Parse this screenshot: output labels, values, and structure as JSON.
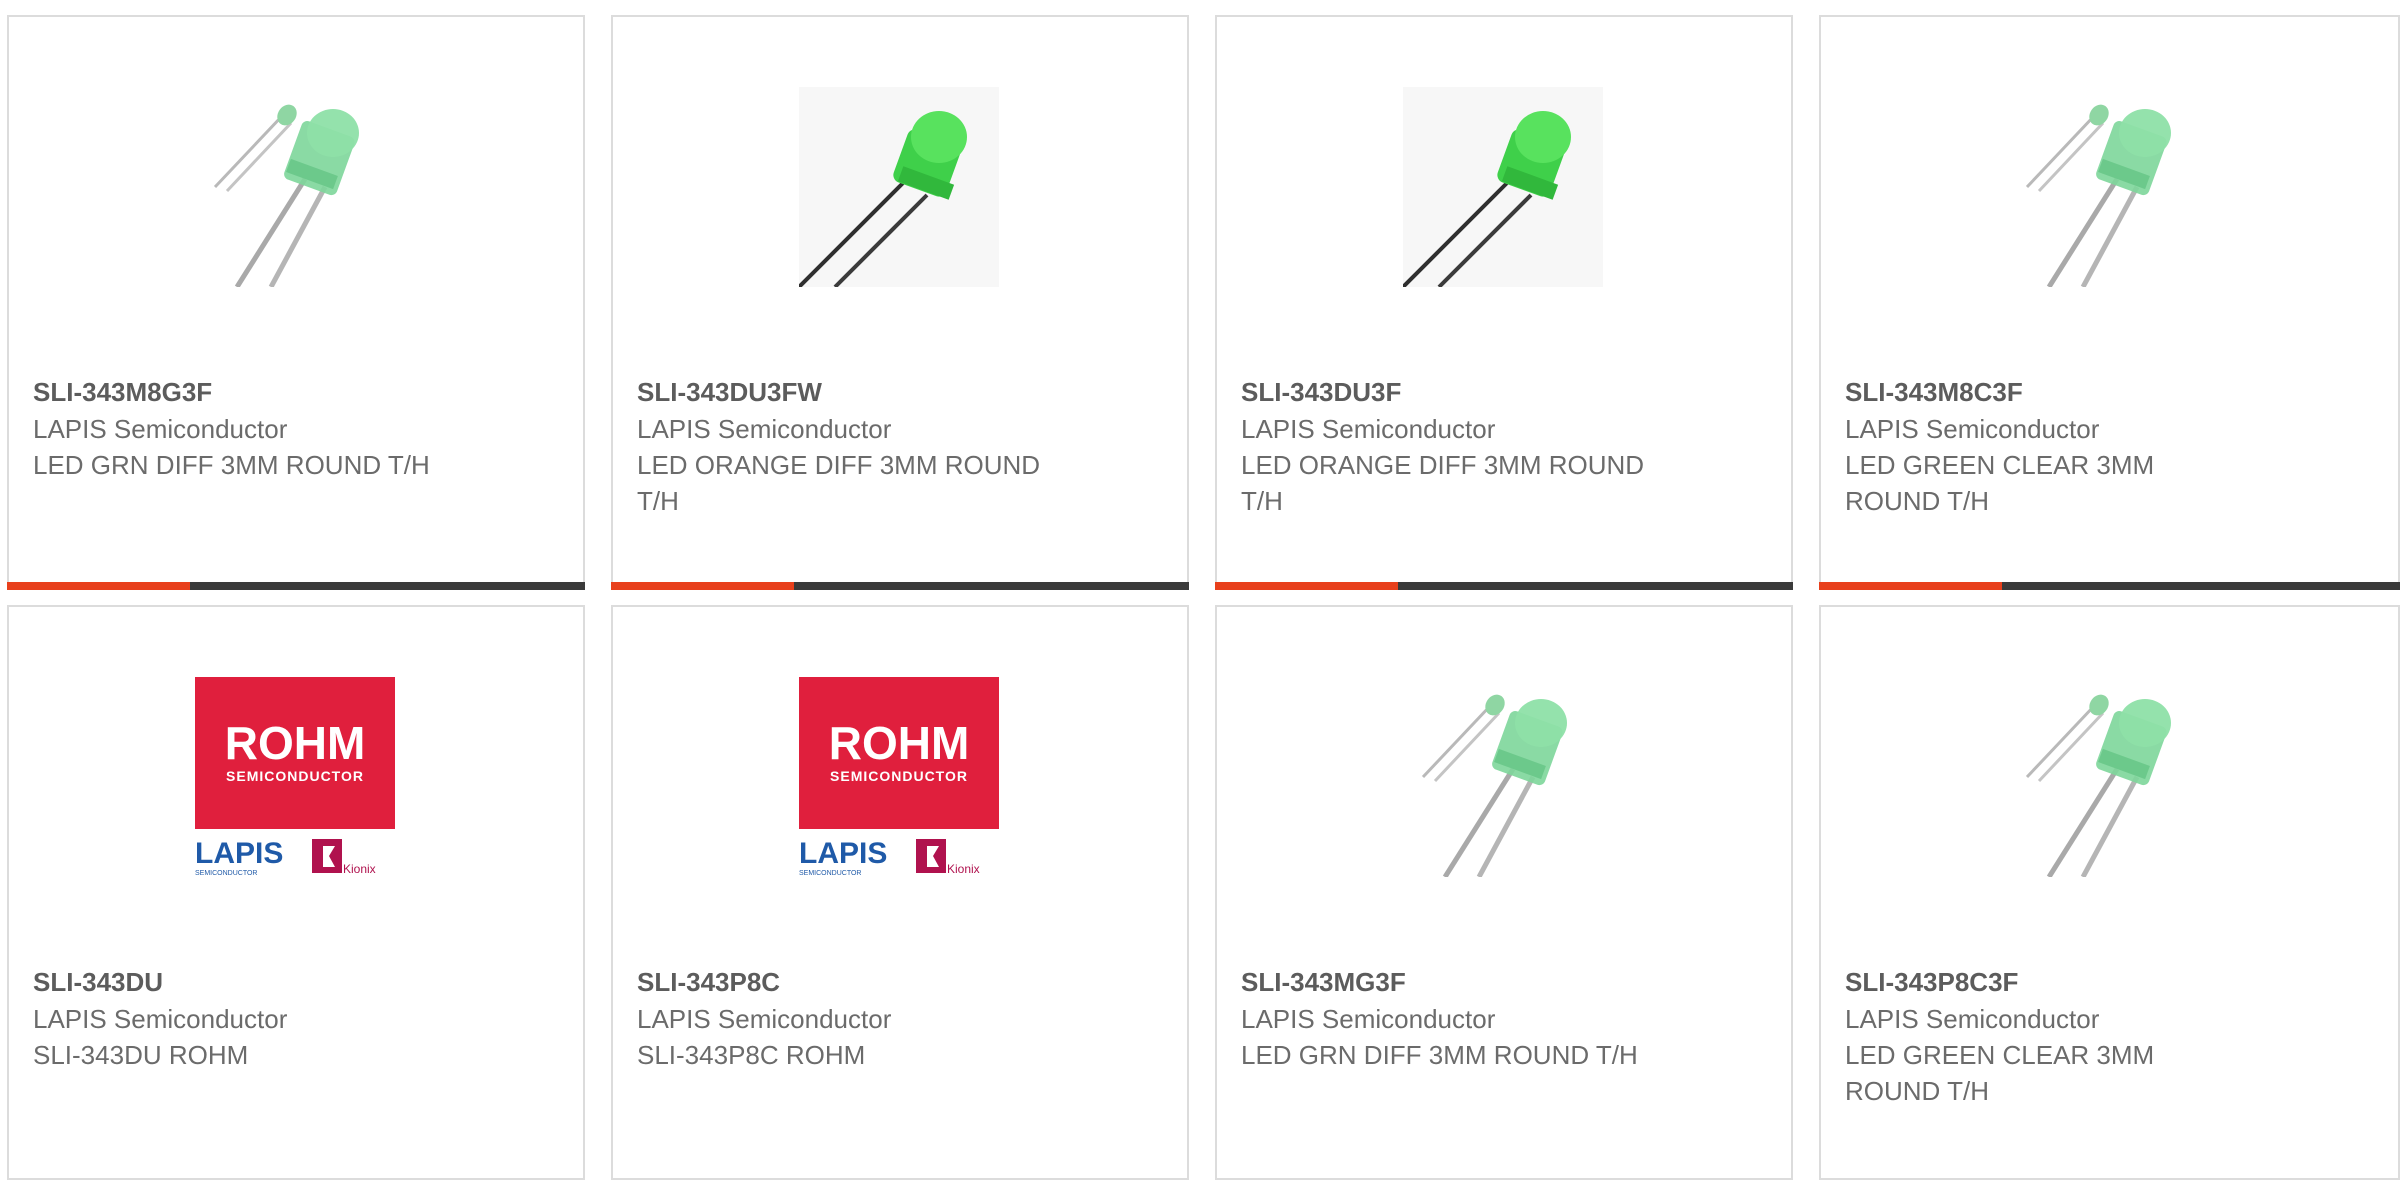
{
  "accent_color": "#e8401c",
  "bar_color": "#3a3a3a",
  "products": [
    {
      "part_number": "SLI-343M8G3F",
      "manufacturer": "LAPIS Semiconductor",
      "description": "LED GRN DIFF 3MM ROUND T/H",
      "image": "led-green-diffused-with-small-led"
    },
    {
      "part_number": "SLI-343DU3FW",
      "manufacturer": "LAPIS Semiconductor",
      "description": "LED ORANGE DIFF 3MM ROUND T/H",
      "image": "led-green-flanged"
    },
    {
      "part_number": "SLI-343DU3F",
      "manufacturer": "LAPIS Semiconductor",
      "description": "LED ORANGE DIFF 3MM ROUND T/H",
      "image": "led-green-flanged"
    },
    {
      "part_number": "SLI-343M8C3F",
      "manufacturer": "LAPIS Semiconductor",
      "description": "LED GREEN CLEAR 3MM ROUND T/H",
      "image": "led-green-diffused-with-small-led"
    },
    {
      "part_number": "SLI-343DU",
      "manufacturer": "LAPIS Semiconductor",
      "description": "SLI-343DU ROHM",
      "image": "rohm-lapis-kionix-logo"
    },
    {
      "part_number": "SLI-343P8C",
      "manufacturer": "LAPIS Semiconductor",
      "description": "SLI-343P8C ROHM",
      "image": "rohm-lapis-kionix-logo"
    },
    {
      "part_number": "SLI-343MG3F",
      "manufacturer": "LAPIS Semiconductor",
      "description": "LED GRN DIFF 3MM ROUND T/H",
      "image": "led-green-diffused-with-small-led"
    },
    {
      "part_number": "SLI-343P8C3F",
      "manufacturer": "LAPIS Semiconductor",
      "description": "LED GREEN CLEAR 3MM ROUND T/H",
      "image": "led-green-diffused-with-small-led"
    }
  ],
  "logo": {
    "rohm_text": "ROHM",
    "rohm_sub": "SEMICONDUCTOR",
    "lapis_text": "LAPIS",
    "lapis_sub": "SEMICONDUCTOR",
    "kionix_text": "Kionix"
  }
}
